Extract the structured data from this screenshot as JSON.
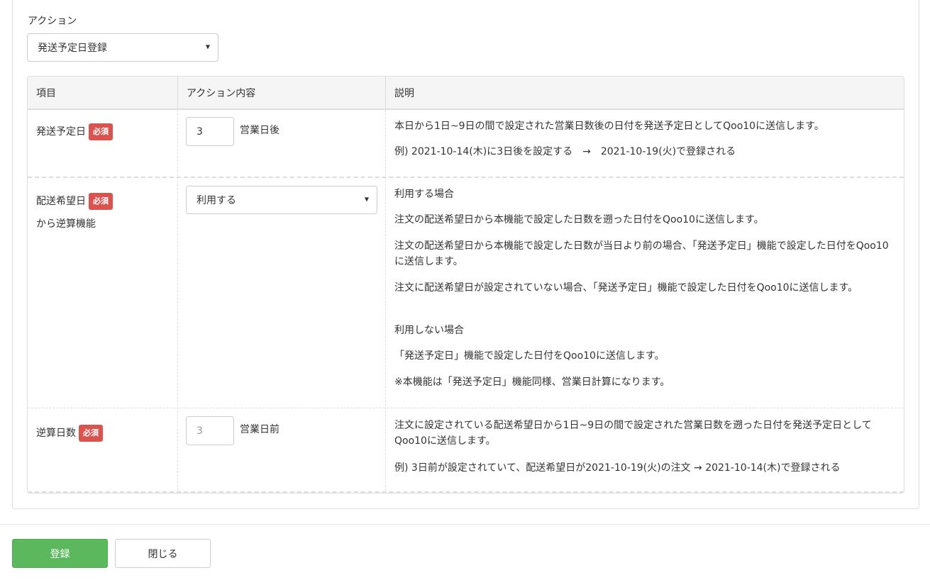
{
  "action": {
    "label": "アクション",
    "selected": "発送予定日登録"
  },
  "table": {
    "headers": [
      "項目",
      "アクション内容",
      "説明"
    ],
    "required_badge": "必須",
    "rows": [
      {
        "item": "発送予定日",
        "input_value": "3",
        "unit": "営業日後",
        "description": [
          "本日から1日~9日の間で設定された営業日数後の日付を発送予定日としてQoo10に送信します。",
          "例) 2021-10-14(木)に3日後を設定する　→　2021-10-19(火)で登録される"
        ]
      },
      {
        "item_line1": "配送希望日",
        "item_line2": "から逆算機能",
        "select_value": "利用する",
        "description": [
          "利用する場合",
          "注文の配送希望日から本機能で設定した日数を遡った日付をQoo10に送信します。",
          "注文の配送希望日から本機能で設定した日数が当日より前の場合、「発送予定日」機能で設定した日付をQoo10に送信します。",
          "注文に配送希望日が設定されていない場合、「発送予定日」機能で設定した日付をQoo10に送信します。",
          "利用しない場合",
          "「発送予定日」機能で設定した日付をQoo10に送信します。",
          "※本機能は「発送予定日」機能同様、営業日計算になります。"
        ]
      },
      {
        "item": "逆算日数",
        "input_placeholder": "3",
        "unit": "営業日前",
        "description": [
          "注文に設定されている配送希望日から1日~9日の間で設定された営業日数を遡った日付を発送予定日としてQoo10に送信します。",
          "例) 3日前が設定されていて、配送希望日が2021-10-19(火)の注文 → 2021-10-14(木)で登録される"
        ]
      }
    ]
  },
  "buttons": {
    "submit": "登録",
    "close": "閉じる"
  },
  "colors": {
    "primary": "#5cb85c",
    "badge": "#d9534f",
    "header_bg": "#f5f5f5"
  }
}
